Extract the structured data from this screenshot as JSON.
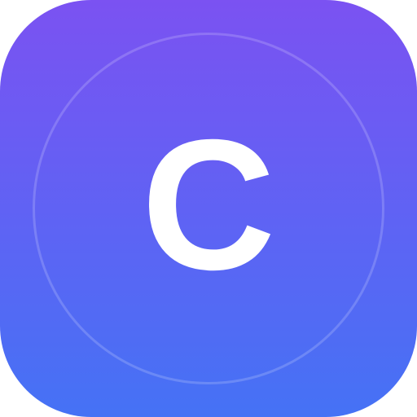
{
  "app_icon": {
    "letter": "C",
    "colors": {
      "gradient_top": "#7b52f2",
      "gradient_bottom": "#4572f5",
      "ring": "#ffffff",
      "letter": "#ffffff"
    }
  }
}
